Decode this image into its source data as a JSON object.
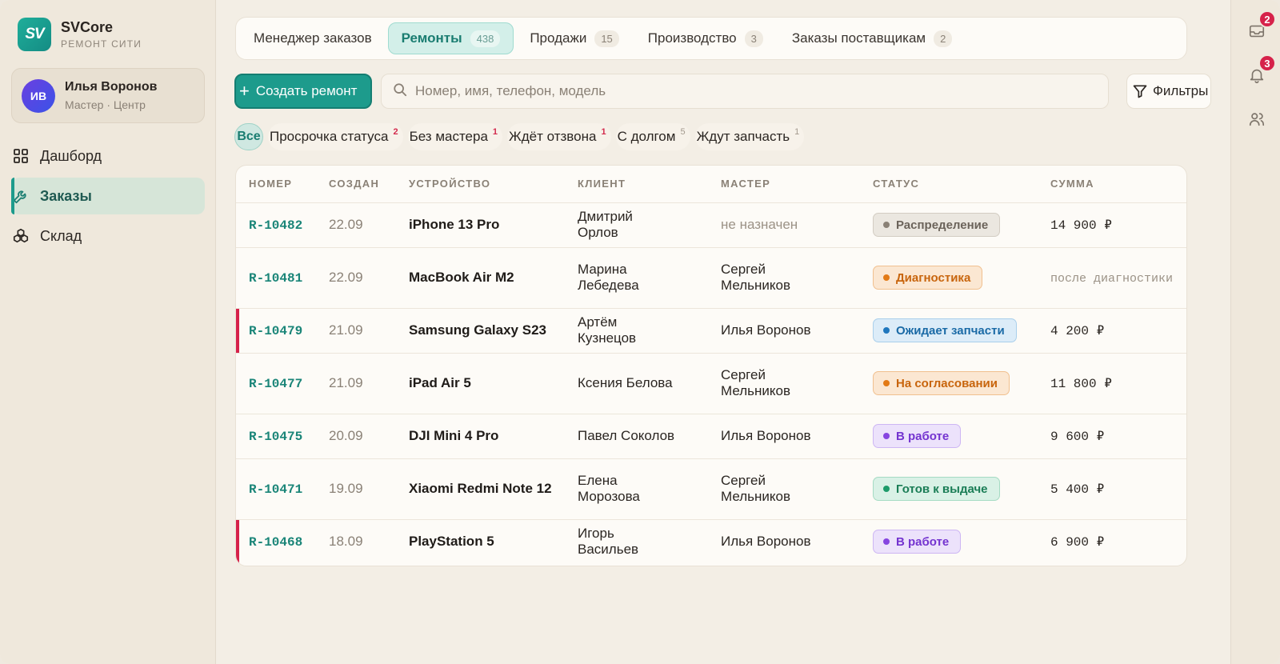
{
  "brand": {
    "name": "SVCore",
    "subtitle": "РЕМОНТ СИТИ",
    "logo_text": "SV"
  },
  "user": {
    "initials": "ИВ",
    "name": "Илья Воронов",
    "role": "Мастер · Центр"
  },
  "nav": [
    {
      "label": "Дашборд",
      "icon": "grid-icon",
      "active": false
    },
    {
      "label": "Заказы",
      "icon": "wrench-icon",
      "active": true
    },
    {
      "label": "Склад",
      "icon": "boxes-icon",
      "active": false
    }
  ],
  "tabs": [
    {
      "label": "Менеджер заказов",
      "count": ""
    },
    {
      "label": "Ремонты",
      "count": "438",
      "active": true
    },
    {
      "label": "Продажи",
      "count": "15"
    },
    {
      "label": "Производство",
      "count": "3"
    },
    {
      "label": "Заказы поставщикам",
      "count": "2"
    }
  ],
  "toolbar": {
    "create_label": "Создать ремонт",
    "search_placeholder": "Номер, имя, телефон, модель",
    "filters_label": "Фильтры"
  },
  "chips": [
    {
      "label": "Все",
      "count": "",
      "active": true
    },
    {
      "label": "Просрочка статуса",
      "count": "2",
      "alert": true
    },
    {
      "label": "Без мастера",
      "count": "1",
      "alert": true
    },
    {
      "label": "Ждёт отзвона",
      "count": "1",
      "alert": true
    },
    {
      "label": "С долгом",
      "count": "5",
      "alert": false
    },
    {
      "label": "Ждут запчасть",
      "count": "1",
      "alert": false
    }
  ],
  "table": {
    "headers": [
      "НОМЕР",
      "СОЗДАН",
      "УСТРОЙСТВО",
      "КЛИЕНТ",
      "МАСТЕР",
      "СТАТУС",
      "СУММА"
    ],
    "rows": [
      {
        "number": "R-10482",
        "created": "22.09",
        "device": "iPhone 13 Pro",
        "client": "Дмитрий Орлов",
        "master": "не назначен",
        "master_muted": true,
        "status": "Распределение",
        "status_key": "gray",
        "amount": "14 900 ₽",
        "amount_muted": false,
        "flag": false,
        "tall": false
      },
      {
        "number": "R-10481",
        "created": "22.09",
        "device": "MacBook Air M2",
        "client": "Марина Лебедева",
        "master": "Сергей Мельников",
        "master_muted": false,
        "status": "Диагностика",
        "status_key": "orange",
        "amount": "после диагностики",
        "amount_muted": true,
        "flag": false,
        "tall": true
      },
      {
        "number": "R-10479",
        "created": "21.09",
        "device": "Samsung Galaxy S23",
        "client": "Артём Кузнецов",
        "master": "Илья Воронов",
        "master_muted": false,
        "status": "Ожидает запчасти",
        "status_key": "blue",
        "amount": "4 200 ₽",
        "amount_muted": false,
        "flag": true,
        "tall": false
      },
      {
        "number": "R-10477",
        "created": "21.09",
        "device": "iPad Air 5",
        "client": "Ксения Белова",
        "master": "Сергей Мельников",
        "master_muted": false,
        "status": "На согласовании",
        "status_key": "orange",
        "amount": "11 800 ₽",
        "amount_muted": false,
        "flag": false,
        "tall": true
      },
      {
        "number": "R-10475",
        "created": "20.09",
        "device": "DJI Mini 4 Pro",
        "client": "Павел Соколов",
        "master": "Илья Воронов",
        "master_muted": false,
        "status": "В работе",
        "status_key": "purple",
        "amount": "9 600 ₽",
        "amount_muted": false,
        "flag": false,
        "tall": false
      },
      {
        "number": "R-10471",
        "created": "19.09",
        "device": "Xiaomi Redmi Note 12",
        "client": "Елена Морозова",
        "master": "Сергей Мельников",
        "master_muted": false,
        "status": "Готов к выдаче",
        "status_key": "green",
        "amount": "5 400 ₽",
        "amount_muted": false,
        "flag": false,
        "tall": true
      },
      {
        "number": "R-10468",
        "created": "18.09",
        "device": "PlayStation 5",
        "client": "Игорь Васильев",
        "master": "Илья Воронов",
        "master_muted": false,
        "status": "В работе",
        "status_key": "purple",
        "amount": "6 900 ₽",
        "amount_muted": false,
        "flag": true,
        "tall": false
      }
    ]
  },
  "status_colors": {
    "gray": {
      "bg": "#ebe7e0",
      "border": "#d3cdc3",
      "text": "#6b635a",
      "dot": "#8a8176"
    },
    "orange": {
      "bg": "#fbe7d2",
      "border": "#f1c08f",
      "text": "#c8650d",
      "dot": "#e27a16"
    },
    "blue": {
      "bg": "#dcecf8",
      "border": "#a9cfeb",
      "text": "#1a6aa6",
      "dot": "#1f77bd"
    },
    "purple": {
      "bg": "#ece2fb",
      "border": "#cdb6f3",
      "text": "#7434d0",
      "dot": "#8645e0"
    },
    "green": {
      "bg": "#d9f1e6",
      "border": "#a5dbc3",
      "text": "#1a7d56",
      "dot": "#1d9b6a"
    }
  },
  "rail": [
    {
      "icon": "inbox-icon",
      "badge": "2"
    },
    {
      "icon": "bell-icon",
      "badge": "3"
    },
    {
      "icon": "users-icon",
      "badge": ""
    }
  ],
  "accent": "#1d9b8c"
}
